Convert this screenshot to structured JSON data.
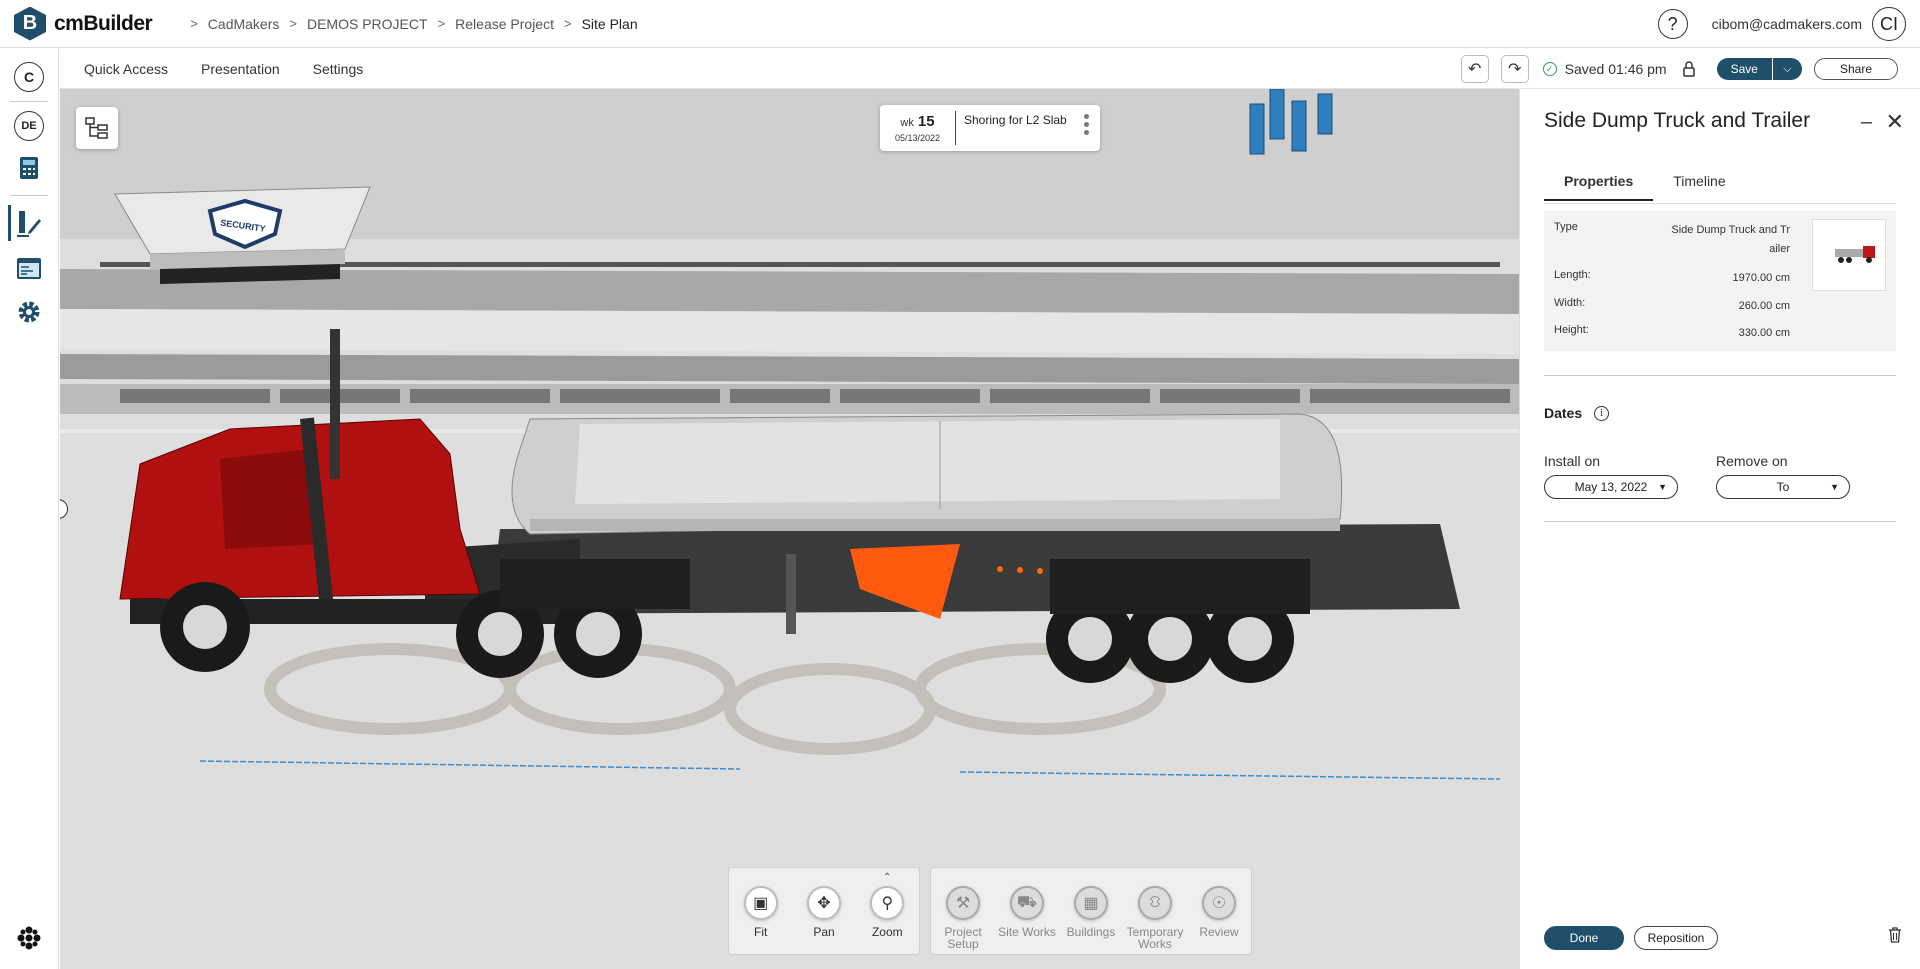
{
  "app": {
    "logo_letter": "B",
    "name": "cmBuilder"
  },
  "breadcrumb": [
    "CadMakers",
    "DEMOS PROJECT",
    "Release Project",
    "Site Plan"
  ],
  "user": {
    "help": "?",
    "email": "cibom@cadmakers.com",
    "initials": "CI"
  },
  "leftrail": {
    "company_initial": "C",
    "project_initials": "DE"
  },
  "toolbar": {
    "menu": [
      "Quick Access",
      "Presentation",
      "Settings"
    ],
    "saved_text": "Saved 01:46 pm",
    "save_label": "Save",
    "share_label": "Share"
  },
  "timeline_card": {
    "wk_label": "wk",
    "week": "15",
    "date": "05/13/2022",
    "task": "Shoring for L2 Slab"
  },
  "scene": {
    "sign_text": "SECURITY"
  },
  "nav_controls": [
    {
      "icon": "fit-icon",
      "label": "Fit"
    },
    {
      "icon": "pan-icon",
      "label": "Pan"
    },
    {
      "icon": "zoom-icon",
      "label": "Zoom"
    }
  ],
  "tools": [
    {
      "icon": "tools-icon",
      "label": "Project\nSetup"
    },
    {
      "icon": "excavator-icon",
      "label": "Site Works"
    },
    {
      "icon": "buildings-icon",
      "label": "Buildings"
    },
    {
      "icon": "crane-icon",
      "label": "Temporary\nWorks"
    },
    {
      "icon": "review-icon",
      "label": "Review"
    }
  ],
  "panel": {
    "title": "Side Dump Truck and Trailer",
    "tabs": [
      "Properties",
      "Timeline"
    ],
    "active_tab": "Properties",
    "properties": [
      {
        "key": "Type",
        "value": "Side Dump Truck and Tr ailer"
      },
      {
        "key": "Length:",
        "value": "1970.00 cm"
      },
      {
        "key": "Width:",
        "value": "260.00 cm"
      },
      {
        "key": "Height:",
        "value": "330.00 cm"
      }
    ],
    "dates_label": "Dates",
    "install_label": "Install on",
    "install_value": "May 13, 2022",
    "remove_label": "Remove on",
    "remove_value": "To",
    "done_label": "Done",
    "reposition_label": "Reposition"
  },
  "colors": {
    "brand": "#1f4f6b",
    "truck": "#b01010",
    "accent_orange": "#ff5a10"
  }
}
